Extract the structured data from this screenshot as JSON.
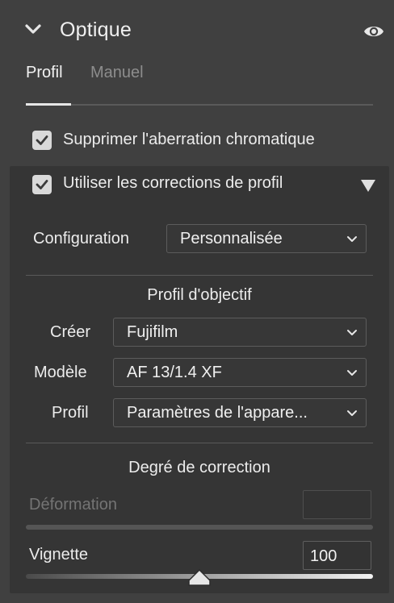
{
  "section": {
    "title": "Optique"
  },
  "tabs": [
    {
      "label": "Profil",
      "active": true
    },
    {
      "label": "Manuel",
      "active": false
    }
  ],
  "checks": {
    "chromatic": {
      "label": "Supprimer l'aberration chromatique",
      "checked": true
    },
    "profile_corrections": {
      "label": "Utiliser les corrections de profil",
      "checked": true
    }
  },
  "configuration": {
    "label": "Configuration",
    "value": "Personnalisée"
  },
  "lens_profile": {
    "heading": "Profil d'objectif",
    "make": {
      "label": "Créer",
      "value": "Fujifilm"
    },
    "model": {
      "label": "Modèle",
      "value": "AF 13/1.4 XF"
    },
    "profile": {
      "label": "Profil",
      "value": "Paramètres de l'appare..."
    }
  },
  "correction": {
    "heading": "Degré de correction",
    "distortion": {
      "label": "Déformation",
      "value": "",
      "disabled": true
    },
    "vignette": {
      "label": "Vignette",
      "value": "100",
      "slider_fraction": 0.5
    }
  },
  "icons": [
    "chevron-down-icon",
    "eye-icon",
    "checkmark-icon",
    "triangle-down-icon",
    "select-chevron-icon",
    "slider-thumb-icon"
  ],
  "colors": {
    "background": "#404040",
    "panel": "#353535",
    "text": "#e8e8e8",
    "muted": "#8d8d8d",
    "disabled_text": "#747474"
  }
}
